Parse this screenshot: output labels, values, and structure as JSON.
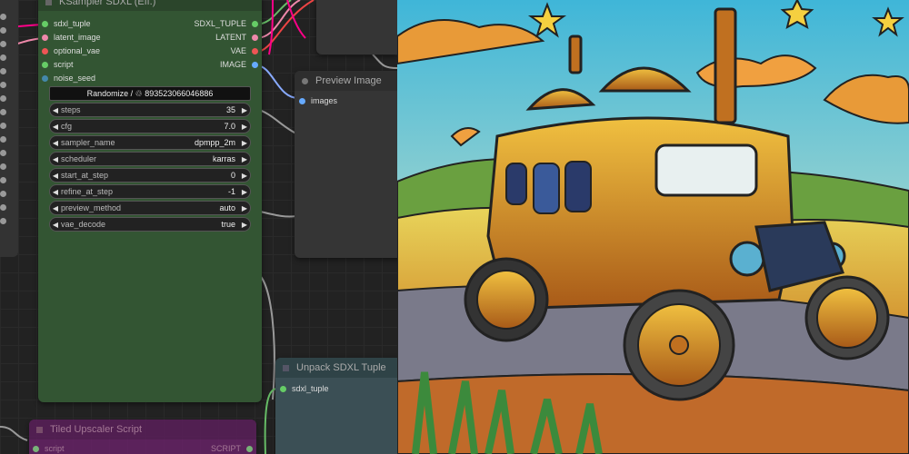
{
  "ksampler": {
    "title": "KSampler SDXL (Eff.)",
    "inputs": [
      "sdxl_tuple",
      "latent_image",
      "optional_vae",
      "script",
      "noise_seed"
    ],
    "outputs": [
      "SDXL_TUPLE",
      "LATENT",
      "VAE",
      "IMAGE"
    ],
    "seed_control": "Randomize / ♲ 893523066046886",
    "widgets": [
      {
        "name": "steps",
        "value": "35"
      },
      {
        "name": "cfg",
        "value": "7.0"
      },
      {
        "name": "sampler_name",
        "value": "dpmpp_2m"
      },
      {
        "name": "scheduler",
        "value": "karras"
      },
      {
        "name": "start_at_step",
        "value": "0"
      },
      {
        "name": "refine_at_step",
        "value": "-1"
      },
      {
        "name": "preview_method",
        "value": "auto"
      },
      {
        "name": "vae_decode",
        "value": "true"
      }
    ]
  },
  "preview": {
    "title": "Preview Image",
    "input": "images"
  },
  "unpack": {
    "title": "Unpack SDXL Tuple",
    "input": "sdxl_tuple"
  },
  "tiled": {
    "title": "Tiled Upscaler Script",
    "input": "script",
    "output": "SCRIPT"
  },
  "colors": {
    "ksampler_bg": "#335533",
    "preview_bg": "#353535",
    "unpack_bg": "#335560",
    "tiled_bg": "#662266"
  },
  "image": {
    "subject": "steampunk car illustration"
  }
}
